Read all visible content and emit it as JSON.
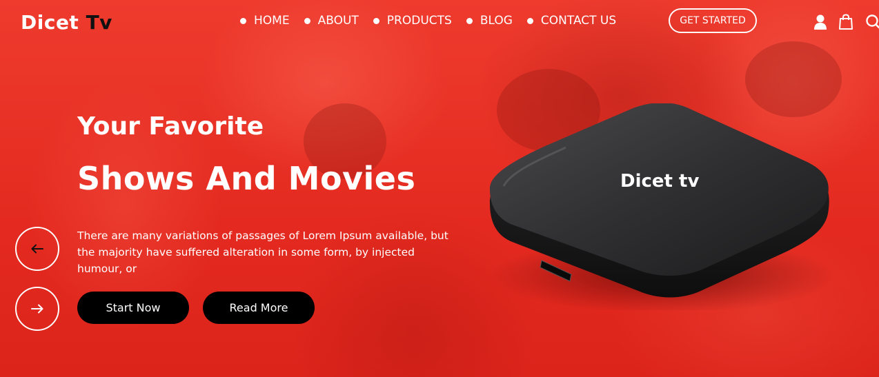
{
  "brand": {
    "name_part1": "Dicet",
    "name_part2": "Tv"
  },
  "nav": {
    "items": [
      {
        "label": "HOME"
      },
      {
        "label": "ABOUT"
      },
      {
        "label": "PRODUCTS"
      },
      {
        "label": "BLOG"
      },
      {
        "label": "CONTACT US"
      }
    ],
    "cta_label": "GET STARTED",
    "icons": [
      "user-icon",
      "shopping-bag-icon",
      "search-icon"
    ]
  },
  "hero": {
    "title_line1": "Your Favorite",
    "title_line2": "Shows And Movies",
    "description": "There are many variations of passages of Lorem Ipsum available, but the majority have suffered alteration in some form, by injected humour, or",
    "primary_button": "Start Now",
    "secondary_button": "Read More",
    "prev_icon": "arrow-left-icon",
    "next_icon": "arrow-right-icon",
    "device_label": "Dicet tv"
  },
  "colors": {
    "accent": "#e0281f",
    "button_bg": "#000000",
    "text": "#ffffff"
  }
}
